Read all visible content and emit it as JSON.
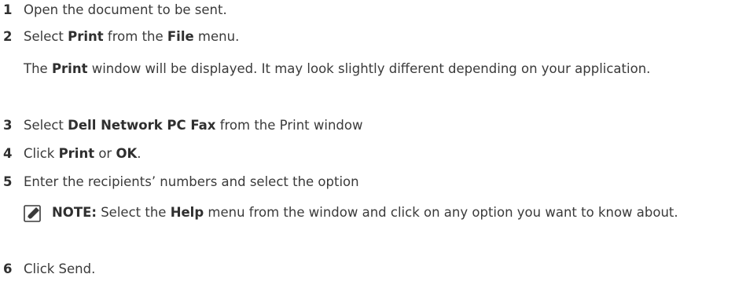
{
  "steps": [
    {
      "num": "1",
      "parts": [
        {
          "t": "Open the document to be sent."
        }
      ]
    },
    {
      "num": "2",
      "parts": [
        {
          "t": "Select "
        },
        {
          "t": "Print",
          "b": true
        },
        {
          "t": " from the "
        },
        {
          "t": "File",
          "b": true
        },
        {
          "t": " menu."
        }
      ]
    },
    {
      "num": "3",
      "parts": [
        {
          "t": "Select "
        },
        {
          "t": "Dell Network PC Fax",
          "b": true
        },
        {
          "t": " from the Print window"
        }
      ]
    },
    {
      "num": "4",
      "parts": [
        {
          "t": "Click "
        },
        {
          "t": "Print",
          "b": true
        },
        {
          "t": " or "
        },
        {
          "t": "OK",
          "b": true
        },
        {
          "t": "."
        }
      ]
    },
    {
      "num": "5",
      "parts": [
        {
          "t": "Enter the recipients’ numbers and select the option"
        }
      ]
    },
    {
      "num": "6",
      "parts": [
        {
          "t": "Click Send."
        }
      ]
    }
  ],
  "step2_detail": [
    {
      "t": "The "
    },
    {
      "t": "Print",
      "b": true
    },
    {
      "t": " window will be displayed. It may look slightly different depending on your application."
    }
  ],
  "note": [
    {
      "t": "NOTE:",
      "b": true
    },
    {
      "t": " Select the "
    },
    {
      "t": "Help",
      "b": true
    },
    {
      "t": " menu from the window and click on any option you want to know about."
    }
  ],
  "note_icon": "pencil-note-icon"
}
